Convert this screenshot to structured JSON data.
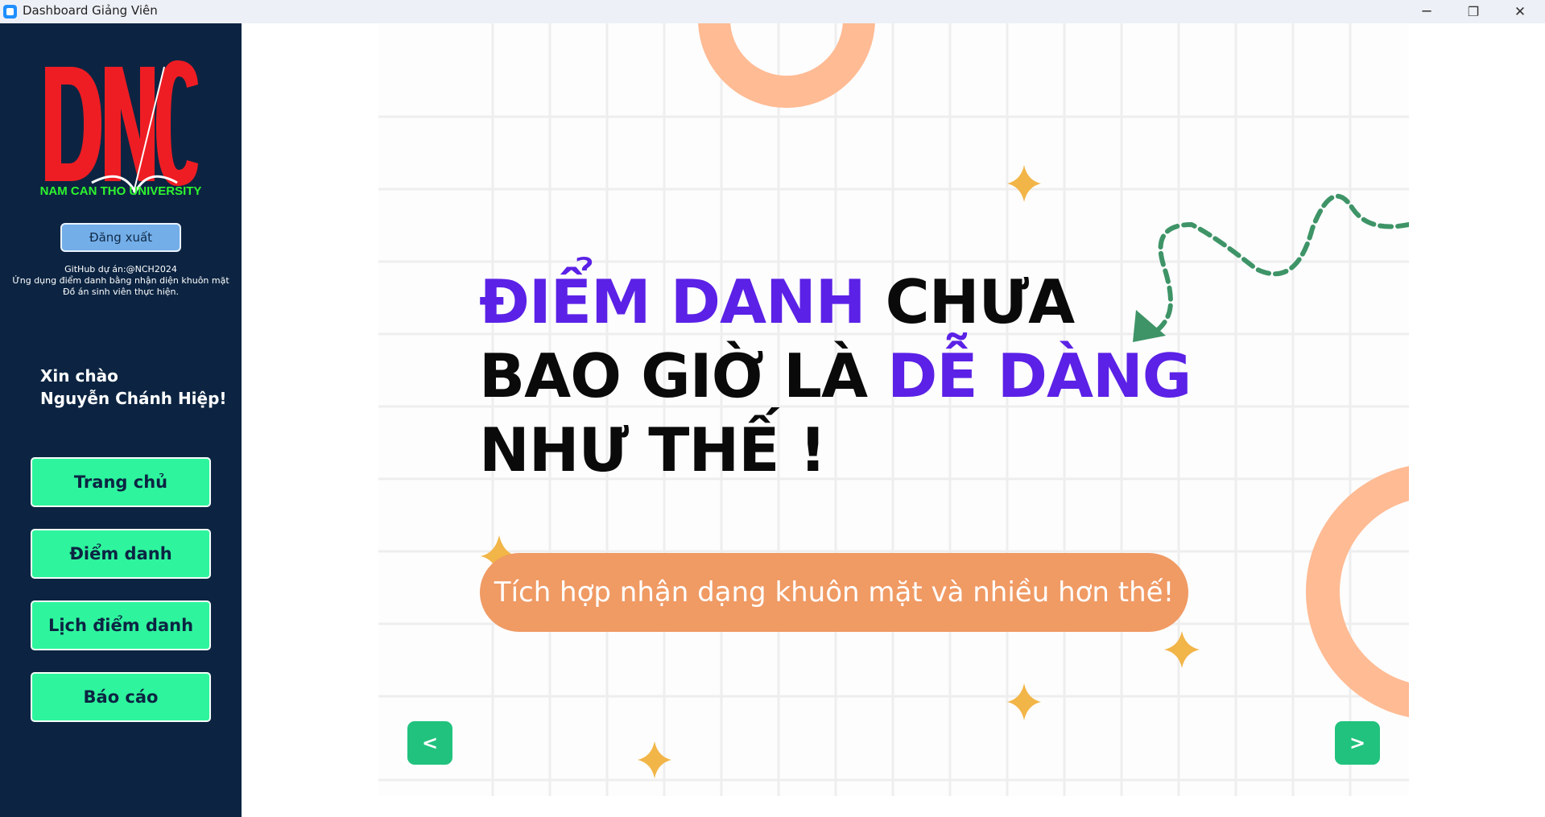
{
  "window": {
    "title": "Dashboard Giảng Viên",
    "controls": {
      "minimize": "─",
      "maximize": "❐",
      "close": "✕"
    }
  },
  "sidebar": {
    "logo": {
      "letters": "DNC",
      "subtitle": "NAM CAN THO UNIVERSITY"
    },
    "logout_label": "Đăng xuất",
    "info_lines": [
      "GitHub dự án:@NCH2024",
      "Ứng dụng điểm danh bằng nhận diện khuôn mặt",
      "Đồ án sinh viên thực hiện."
    ],
    "greeting_line1": "Xin chào",
    "greeting_line2": "Nguyễn Chánh Hiệp!",
    "nav": [
      {
        "label": "Trang chủ"
      },
      {
        "label": "Điểm danh"
      },
      {
        "label": "Lịch điểm danh"
      },
      {
        "label": "Báo cáo"
      }
    ]
  },
  "slide": {
    "headline": {
      "line1_highlight": "ĐIỂM DANH",
      "line1_rest": " CHƯA",
      "line2_start": "BAO GIỜ LÀ ",
      "line2_highlight": "DỄ DÀNG",
      "line3": "NHƯ THẾ !"
    },
    "pill_text": "Tích hợp nhận dạng khuôn mặt và nhiều hơn thế!",
    "prev_label": "<",
    "next_label": ">"
  },
  "colors": {
    "sidebar_bg": "#0c2442",
    "nav_button": "#2ef59d",
    "logout_button": "#73aee8",
    "headline_accent": "#5b21e6",
    "pill": "#f09a64",
    "ring": "#ffbb94",
    "sparkle": "#f2b548",
    "dashed_arrow": "#3e9467",
    "slider_button": "#21c27e"
  }
}
